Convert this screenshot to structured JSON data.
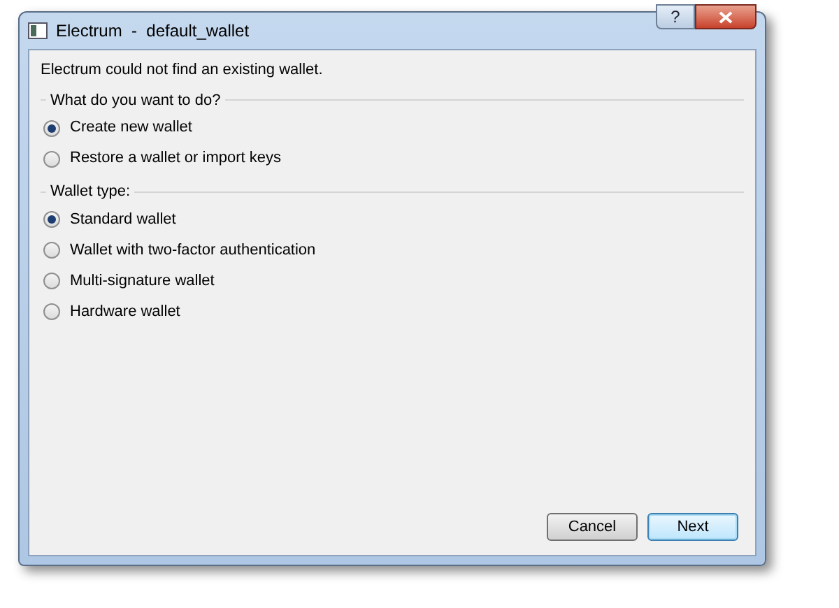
{
  "window": {
    "title": "Electrum  -  default_wallet",
    "help": "?"
  },
  "message": "Electrum could not find an existing wallet.",
  "groups": [
    {
      "title": "What do you want to do?",
      "options": [
        {
          "label": "Create new wallet",
          "selected": true
        },
        {
          "label": "Restore a wallet or import keys",
          "selected": false
        }
      ]
    },
    {
      "title": "Wallet type:",
      "options": [
        {
          "label": "Standard wallet",
          "selected": true
        },
        {
          "label": "Wallet with two-factor authentication",
          "selected": false
        },
        {
          "label": "Multi-signature wallet",
          "selected": false
        },
        {
          "label": "Hardware wallet",
          "selected": false
        }
      ]
    }
  ],
  "buttons": [
    {
      "label": "Cancel",
      "default": false
    },
    {
      "label": "Next",
      "default": true
    }
  ]
}
